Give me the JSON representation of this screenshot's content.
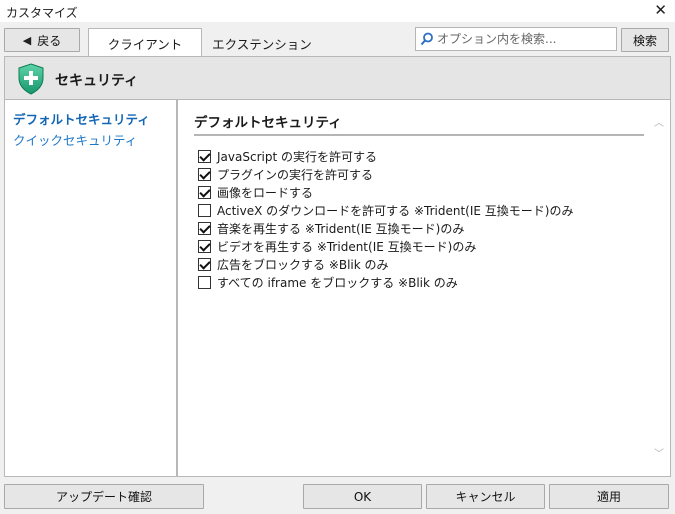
{
  "window": {
    "title": "カスタマイズ",
    "close_glyph": "✕"
  },
  "toolbar": {
    "back_label": "戻る",
    "tabs": [
      {
        "label": "クライアント",
        "active": true
      },
      {
        "label": "エクステンション",
        "active": false
      }
    ],
    "search_placeholder": "オプション内を検索...",
    "search_button": "検索"
  },
  "header": {
    "title": "セキュリティ",
    "icon": "shield-plus-icon",
    "accent": "#2bb38a"
  },
  "sidebar": {
    "items": [
      {
        "label": "デフォルトセキュリティ",
        "selected": true
      },
      {
        "label": "クイックセキュリティ",
        "selected": false
      }
    ]
  },
  "main": {
    "section_title": "デフォルトセキュリティ",
    "options": [
      {
        "label": "JavaScript の実行を許可する",
        "checked": true
      },
      {
        "label": "プラグインの実行を許可する",
        "checked": true
      },
      {
        "label": "画像をロードする",
        "checked": true
      },
      {
        "label": "ActiveX のダウンロードを許可する ※Trident(IE 互換モード)のみ",
        "checked": false
      },
      {
        "label": "音楽を再生する ※Trident(IE 互換モード)のみ",
        "checked": true
      },
      {
        "label": "ビデオを再生する ※Trident(IE 互換モード)のみ",
        "checked": true
      },
      {
        "label": "広告をブロックする ※Blik のみ",
        "checked": true
      },
      {
        "label": "すべての iframe をブロックする ※Blik のみ",
        "checked": false
      }
    ]
  },
  "footer": {
    "update_label": "アップデート確認",
    "ok_label": "OK",
    "cancel_label": "キャンセル",
    "apply_label": "適用"
  }
}
